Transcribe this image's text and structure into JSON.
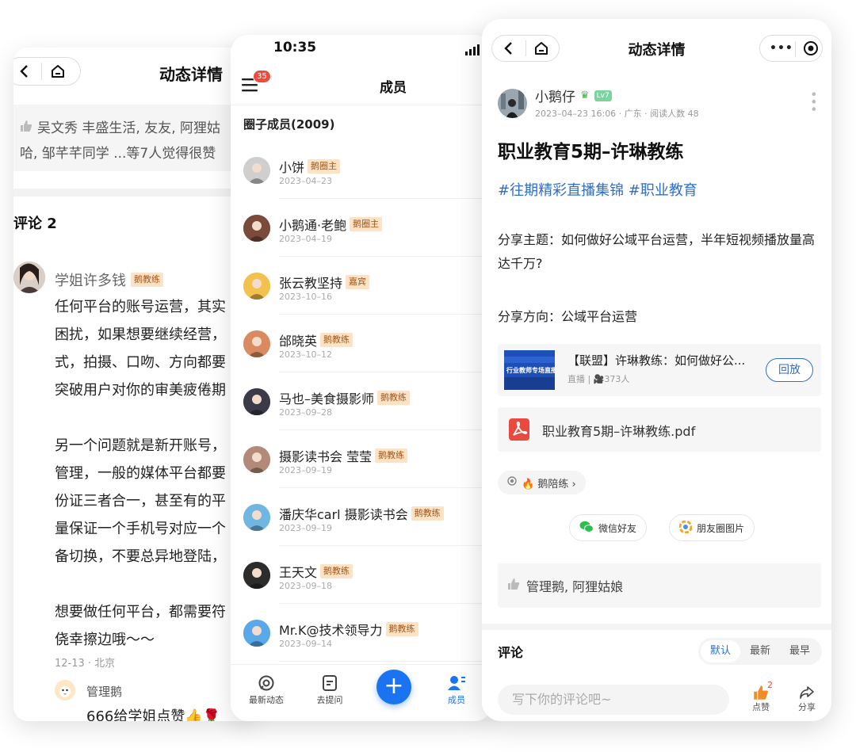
{
  "left": {
    "title": "动态详情",
    "likes_line1": "吴文秀 丰盛生活, 友友, 阿狸姑",
    "likes_line2": "哈, 邹芊芊同学 ...等7人觉得很赞",
    "comment_header": "评论 2",
    "commenter": "学姐许多钱",
    "commenter_tag": "鹅教练",
    "comment_lines": [
      "任何平台的账号运营，其实",
      "困扰，如果想要继续经营，",
      "式，拍摄、口吻、方向都要",
      "突破用户对你的审美疲倦期",
      "",
      "另一个问题就是新开账号，",
      "管理，一般的媒体平台都要",
      "份证三者合一，甚至有的平",
      "量保证一个手机号对应一个",
      "备切换，不要总异地登陆，",
      "",
      "想要做任何平台，都需要符",
      "侥幸擦边哦～～"
    ],
    "comment_meta": "12-13 · 北京",
    "reply_name": "管理鹅",
    "reply_text": "666给学姐点赞👍🌹"
  },
  "middle": {
    "time": "10:35",
    "title": "成员",
    "badge": "35",
    "section": "圈子成员(2009)",
    "members": [
      {
        "name": "小饼",
        "tag": "鹅圈主",
        "date": "2023–04–23",
        "color": "#cfcfcf"
      },
      {
        "name": "小鹅通·老鲍",
        "tag": "鹅圈主",
        "date": "2023–04–19",
        "color": "#7a4a3a"
      },
      {
        "name": "张云教坚持",
        "tag": "嘉宾",
        "date": "2023–10–16",
        "color": "#f2c14e"
      },
      {
        "name": "邰晓英",
        "tag": "鹅教练",
        "date": "2023–10–12",
        "color": "#d98b5f"
      },
      {
        "name": "马也–美食摄影师",
        "tag": "鹅教练",
        "date": "2023–09–28",
        "color": "#3a3a48"
      },
      {
        "name": "摄影读书会 莹莹",
        "tag": "鹅教练",
        "date": "2023–09–19",
        "color": "#b38a7a"
      },
      {
        "name": "潘庆华carl 摄影读书会",
        "tag": "鹅教练",
        "date": "2023–09–19",
        "color": "#6fb6e0"
      },
      {
        "name": "王天文",
        "tag": "鹅教练",
        "date": "2023–09–18",
        "color": "#2c2c2c"
      },
      {
        "name": "Mr.K@技术领导力",
        "tag": "鹅教练",
        "date": "2023–09–14",
        "color": "#5aa8e8"
      }
    ],
    "tabs": {
      "feed": "最新动态",
      "ask": "去提问",
      "members": "成员"
    }
  },
  "right": {
    "title": "动态详情",
    "author": "小鹅仔",
    "level": "Lv7",
    "meta": "2023–04–23 16:06 · 广东 · 阅读人数 48",
    "headline": "职业教育5期–许琳教练",
    "hashtags": "#往期精彩直播集锦 #职业教育",
    "para1": "分享主题：如何做好公域平台运营，半年短视频播放量高达千万?",
    "para2": "分享方向：公域平台运营",
    "live_title": "【联盟】许琳教练：如何做好公...",
    "live_meta": "直播 | 🎥373人",
    "live_btn": "回放",
    "thumb_text": "行业教师专场直播",
    "pdf_name": "职业教育5期–许琳教练.pdf",
    "chip": "🔥 鹅陪练 ›",
    "share_wechat": "微信好友",
    "share_moments": "朋友圈图片",
    "likes": "管理鹅, 阿狸姑娘",
    "comment_header": "评论",
    "sort": [
      "默认",
      "最新",
      "最早"
    ],
    "input_placeholder": "写下你的评论吧~",
    "like_label": "点赞",
    "like_count": "2",
    "share_label": "分享"
  },
  "colors": {
    "accent": "#2f6fc9",
    "tag_bg": "#fde2c4",
    "badge": "#f04a3e",
    "plus": "#1a73f0"
  }
}
